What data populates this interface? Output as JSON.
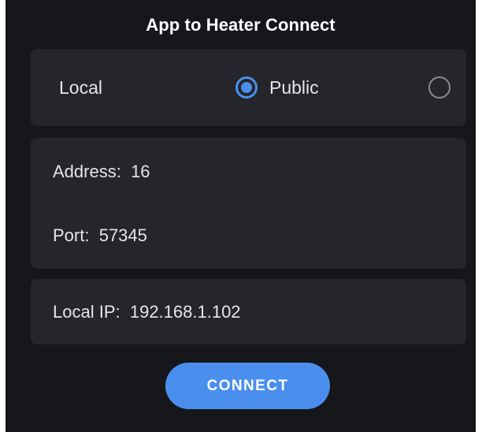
{
  "header": {
    "title": "App to Heater Connect"
  },
  "mode": {
    "options": [
      {
        "label": "Local",
        "selected": true
      },
      {
        "label": "Public",
        "selected": false
      }
    ]
  },
  "connection": {
    "address_label": "Address:",
    "address_value": "16",
    "port_label": "Port:",
    "port_value": "57345",
    "local_ip_label": "Local IP:",
    "local_ip_value": "192.168.1.102"
  },
  "actions": {
    "connect_label": "CONNECT"
  },
  "colors": {
    "background": "#16171b",
    "card": "#25262b",
    "accent": "#4a8fee",
    "text": "#e6e6e6"
  }
}
